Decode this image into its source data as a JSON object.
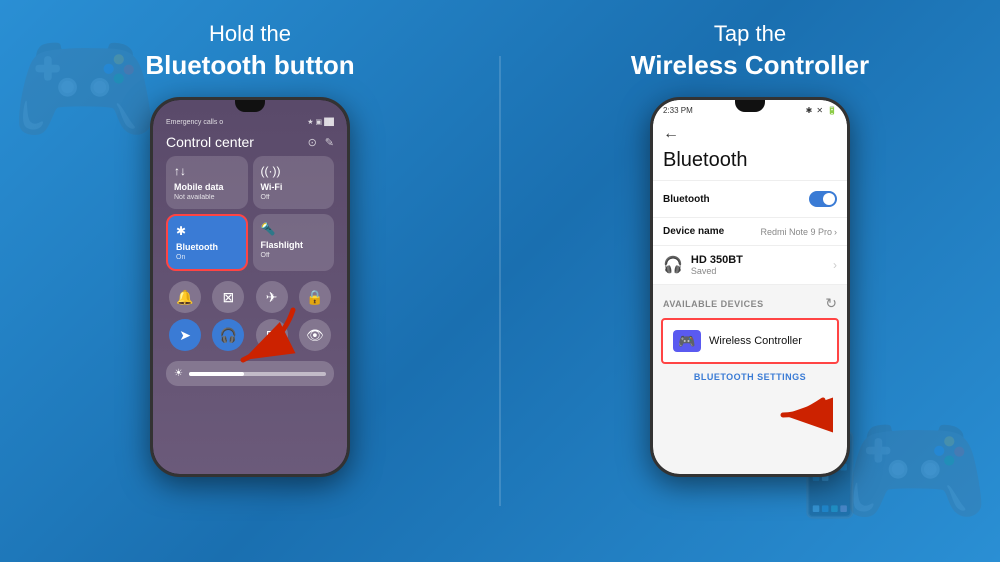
{
  "left": {
    "title_line1": "Hold the",
    "title_line2": "Bluetooth button",
    "phone": {
      "status_left": "Emergency calls o",
      "status_right": "★ ▣ ▪▪",
      "control_center_label": "Control center",
      "tiles": [
        {
          "icon": "📶",
          "name": "Mobile data",
          "status": "Not available"
        },
        {
          "icon": "📡",
          "name": "Wi-Fi",
          "status": "Off"
        },
        {
          "icon": "🔵",
          "name": "Bluetooth",
          "status": "On",
          "active": true
        },
        {
          "icon": "🔦",
          "name": "Flashlight",
          "status": "Off"
        }
      ]
    }
  },
  "right": {
    "title_line1": "Tap the",
    "title_line2": "Wireless Controller",
    "phone": {
      "time": "2:33 PM",
      "status_icons": "★ ✕ 🔋",
      "bluetooth_title": "Bluetooth",
      "bluetooth_label": "Bluetooth",
      "device_name_label": "Device name",
      "device_name_value": "Redmi Note 9 Pro",
      "saved_device_name": "HD 350BT",
      "saved_device_status": "Saved",
      "available_label": "AVAILABLE DEVICES",
      "wireless_controller": "Wireless Controller",
      "bt_settings": "BLUETOOTH SETTINGS"
    }
  }
}
